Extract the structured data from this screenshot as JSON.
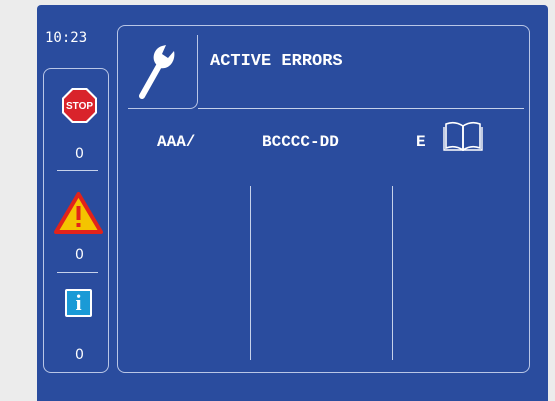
{
  "status": {
    "time": "10:23"
  },
  "sidebar": {
    "stop": {
      "label": "STOP",
      "count": "0",
      "color": "#d9232b"
    },
    "warning": {
      "count": "0",
      "color": "#f4c400"
    },
    "info": {
      "symbol": "i",
      "count": "0",
      "color": "#1a9ad6"
    }
  },
  "panel": {
    "title": "ACTIVE ERRORS",
    "icon": "wrench-icon",
    "columns": [
      "AAA/",
      "BCCCC-DD",
      "E"
    ],
    "manual_icon": "book-icon"
  },
  "theme": {
    "screen_bg": "#2a4c9e",
    "frame_bg": "#ececec",
    "line": "#c6d1ea"
  }
}
